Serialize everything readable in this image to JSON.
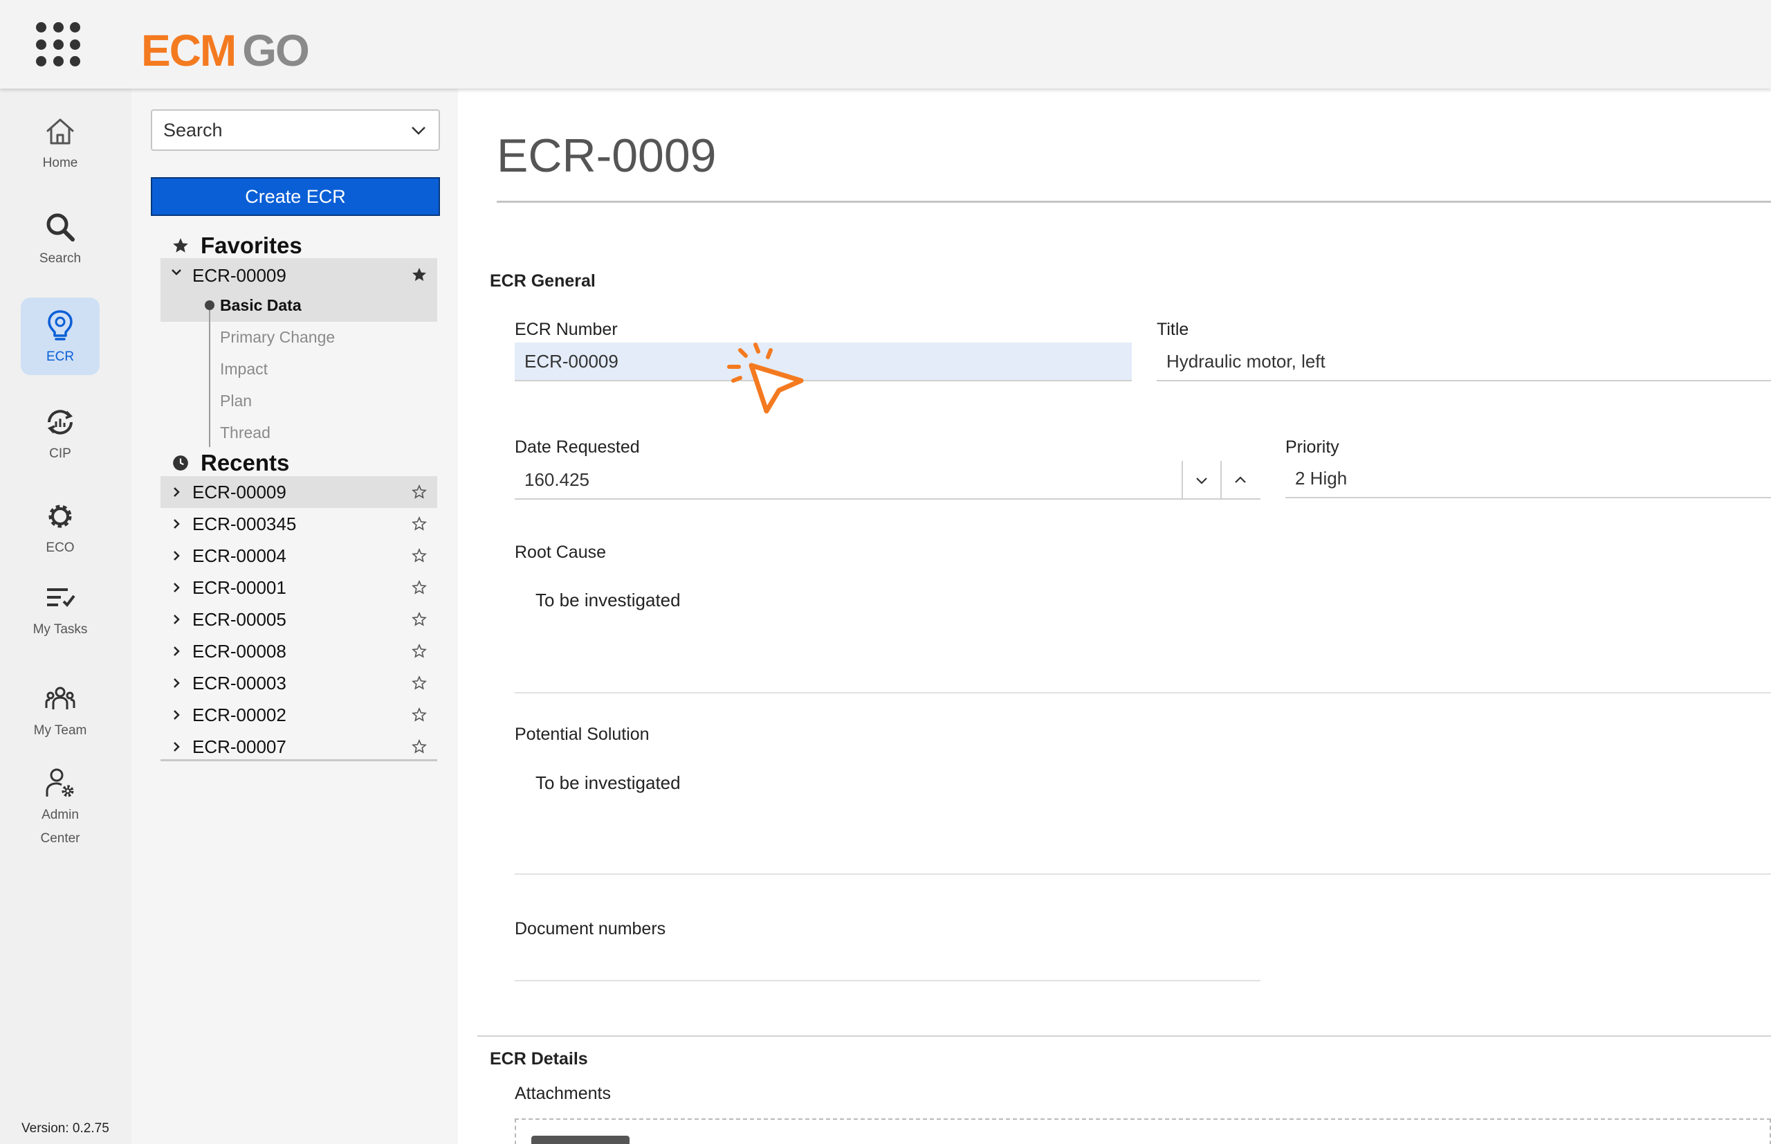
{
  "header": {
    "logo_ecm": "ECM",
    "logo_go": "GO"
  },
  "rail": [
    {
      "label": "Home",
      "icon": "home-icon"
    },
    {
      "label": "Search",
      "icon": "search-icon"
    },
    {
      "label": "ECR",
      "icon": "lightbulb-icon",
      "active": true
    },
    {
      "label": "CIP",
      "icon": "cip-cycle-icon"
    },
    {
      "label": "ECO",
      "icon": "gear-icon"
    },
    {
      "label": "My Tasks",
      "icon": "tasks-icon"
    },
    {
      "label": "My Team",
      "icon": "team-icon"
    },
    {
      "label": "Admin",
      "label2": "Center",
      "icon": "admin-user-gear-icon"
    }
  ],
  "version": "Version: 0.2.75",
  "nav": {
    "search_placeholder": "Search",
    "create_button": "Create ECR",
    "favorites_heading": "Favorites",
    "favorites": [
      {
        "id": "ECR-00009",
        "starred": true,
        "expanded": true
      }
    ],
    "favorite_children": [
      "Basic Data",
      "Primary Change",
      "Impact",
      "Plan",
      "Thread"
    ],
    "recents_heading": "Recents",
    "recents": [
      "ECR-00009",
      "ECR-000345",
      "ECR-00004",
      "ECR-00001",
      "ECR-00005",
      "ECR-00008",
      "ECR-00003",
      "ECR-00002",
      "ECR-00007"
    ]
  },
  "main": {
    "title": "ECR-0009",
    "general_heading": "ECR General",
    "ecr_number_label": "ECR Number",
    "ecr_number_value": "ECR-00009",
    "title_label": "Title",
    "title_value": "Hydraulic motor, left",
    "date_label": "Date Requested",
    "date_value": "160.425",
    "priority_label": "Priority",
    "priority_value": "2 High",
    "root_cause_label": "Root Cause",
    "root_cause_value": "To be investigated",
    "potential_solution_label": "Potential Solution",
    "potential_solution_value": "To be investigated",
    "document_numbers_label": "Document numbers",
    "details_heading": "ECR Details",
    "attachments_label": "Attachments"
  },
  "colors": {
    "brand_orange": "#f47a20",
    "brand_gray": "#8a8a8a",
    "primary_blue": "#0a5fd6",
    "highlight_field": "#e3ecf8"
  }
}
